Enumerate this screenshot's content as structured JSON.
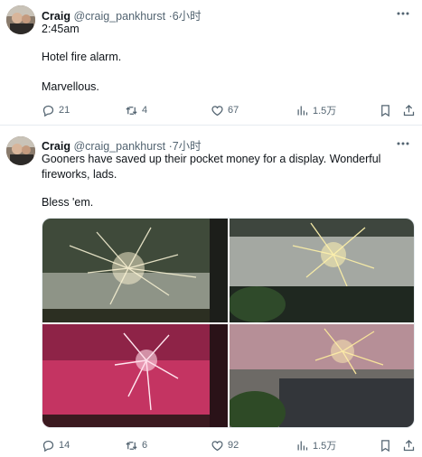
{
  "tweets": [
    {
      "name": "Craig",
      "handle": "@craig_pankhurst",
      "dot": "·",
      "time": "6小时",
      "text_lines": [
        "2:45am",
        "Hotel fire alarm.",
        "Marvellous."
      ],
      "stats": {
        "replies": "21",
        "retweets": "4",
        "likes": "67",
        "views": "1.5万"
      }
    },
    {
      "name": "Craig",
      "handle": "@craig_pankhurst",
      "dot": "·",
      "time": "7小时",
      "text_lines": [
        "Gooners have saved up their pocket money for a display. Wonderful fireworks, lads.",
        "Bless 'em."
      ],
      "stats": {
        "replies": "14",
        "retweets": "6",
        "likes": "92",
        "views": "1.5万"
      }
    }
  ],
  "icons": {
    "more": "more-icon",
    "reply": "reply-icon",
    "retweet": "retweet-icon",
    "like": "heart-icon",
    "views": "views-icon",
    "bookmark": "bookmark-icon",
    "share": "share-icon"
  },
  "colors": {
    "text": "#0f1419",
    "secondary": "#536471",
    "divider": "#e6ecf0"
  }
}
